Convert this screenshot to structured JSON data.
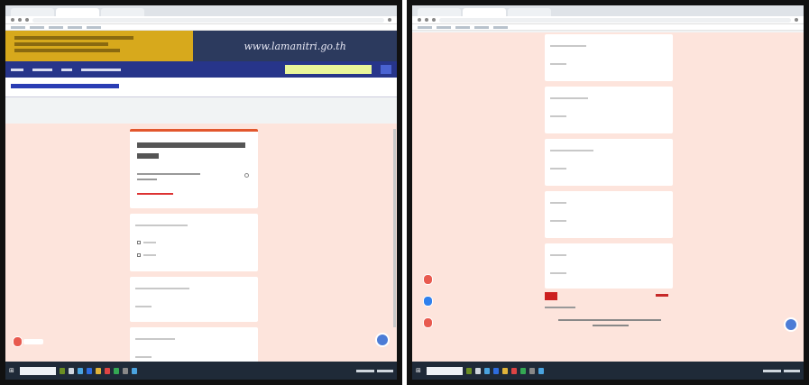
{
  "left_screen": {
    "browser": {
      "tabs": [
        "",
        "",
        ""
      ],
      "bookmarks": [
        "",
        "",
        "",
        "",
        ""
      ]
    },
    "banner": {
      "site_text": "www.lamanitri.go.th"
    },
    "navbar": {
      "items": [
        "",
        "",
        "",
        ""
      ],
      "search_placeholder": ""
    },
    "page_title": "",
    "form": {
      "header_title": "",
      "cards": [
        {
          "question": "",
          "options": [
            "",
            ""
          ]
        },
        {
          "question": "",
          "options": [
            "",
            ""
          ]
        },
        {
          "question": "",
          "options": []
        },
        {
          "question": "",
          "options": []
        }
      ]
    },
    "side_buttons": [
      {
        "color": "#e85a4f",
        "label": ""
      }
    ]
  },
  "right_screen": {
    "browser": {
      "tabs": [
        "",
        "",
        ""
      ],
      "bookmarks": [
        "",
        "",
        "",
        "",
        ""
      ]
    },
    "form": {
      "cards": [
        {
          "question": ""
        },
        {
          "question": ""
        },
        {
          "question": ""
        },
        {
          "question": ""
        },
        {
          "question": ""
        }
      ],
      "submit_label": "",
      "clear_label": "",
      "footer": ""
    },
    "side_buttons": [
      {
        "color": "#e85a4f",
        "label": ""
      },
      {
        "color": "#2f80ed",
        "label": ""
      },
      {
        "color": "#e85a4f",
        "label": ""
      }
    ]
  },
  "colors": {
    "banner_gold": "#d7a91c",
    "banner_navy": "#2c3a5e",
    "navbar": "#27358a",
    "form_background": "#fde4dc",
    "accent": "#e2572d",
    "taskbar": "#1f2a38"
  },
  "icons": {
    "start": "windows-icon",
    "fab": "chat-icon"
  }
}
